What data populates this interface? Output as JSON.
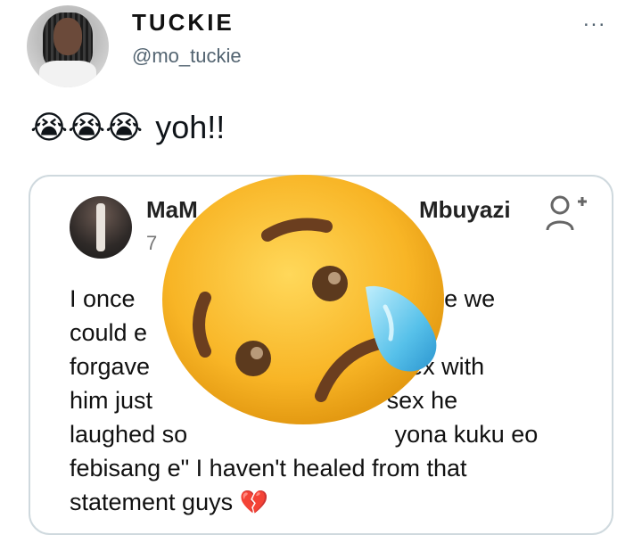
{
  "author": {
    "name": "TUCKIE",
    "handle": "@mo_tuckie",
    "more_label": "..."
  },
  "tweet": {
    "emoji": "😭😭😭",
    "text": "yoh!!"
  },
  "quoted_post": {
    "name_left": "MaM",
    "name_right": "Mbuyazi",
    "time": "7",
    "lines": [
      "I once                                      before we",
      "could e                                      but",
      "forgave                                     sex with",
      "him just                                   sex he",
      "laughed so                               yona kuku eo",
      "febisang e\" I haven't healed from that",
      "statement guys"
    ],
    "end_emoji": "💔"
  },
  "overlay": {
    "icon": "sad-tear-emoji-icon"
  },
  "colors": {
    "accent_gray": "#536471",
    "card_border": "#cfd9de",
    "emoji_yellow": "#f7b51f",
    "tear_blue": "#5cc2ea"
  }
}
